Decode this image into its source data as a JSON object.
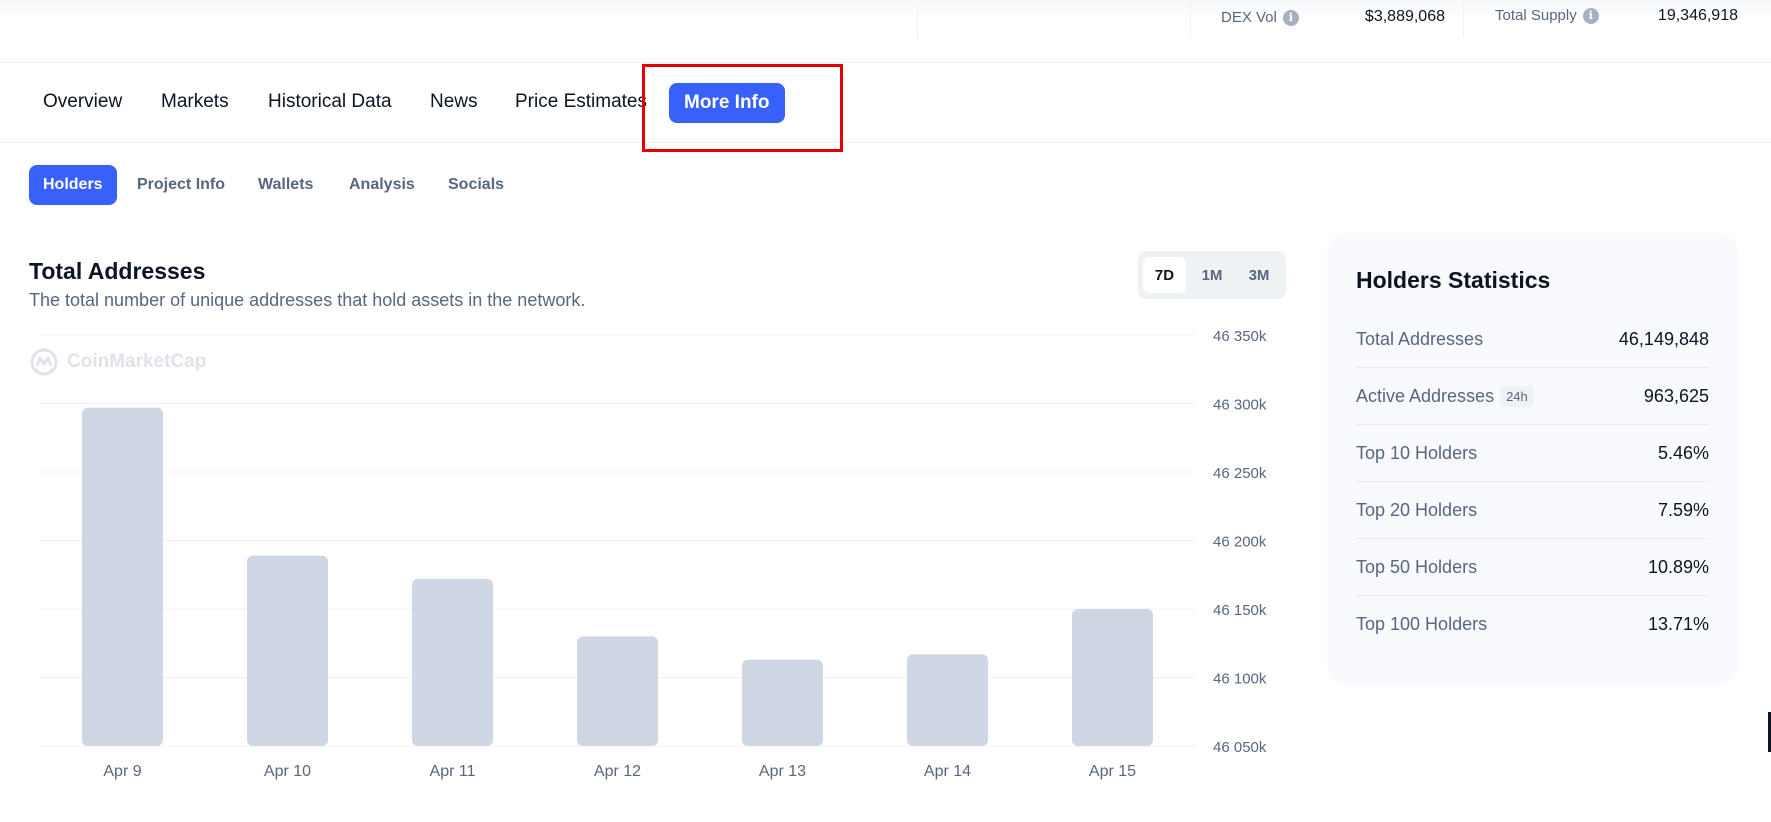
{
  "top_stats": {
    "dex_vol_label": "DEX Vol",
    "dex_vol_value": "$3,889,068",
    "total_supply_label": "Total Supply",
    "total_supply_value": "19,346,918",
    "info_icon_glyph": "i"
  },
  "main_tabs": [
    {
      "label": "Overview"
    },
    {
      "label": "Markets"
    },
    {
      "label": "Historical Data"
    },
    {
      "label": "News"
    },
    {
      "label": "Price Estimates"
    },
    {
      "label": "More Info",
      "active": true
    }
  ],
  "sub_tabs": [
    {
      "label": "Holders",
      "active": true
    },
    {
      "label": "Project Info"
    },
    {
      "label": "Wallets"
    },
    {
      "label": "Analysis"
    },
    {
      "label": "Socials"
    }
  ],
  "chart_section": {
    "title": "Total Addresses",
    "subtitle": "The total number of unique addresses that hold assets in the network.",
    "ranges": [
      {
        "label": "7D",
        "active": true
      },
      {
        "label": "1M"
      },
      {
        "label": "3M"
      }
    ],
    "watermark": "CoinMarketCap"
  },
  "chart_data": {
    "type": "bar",
    "categories": [
      "Apr 9",
      "Apr 10",
      "Apr 11",
      "Apr 12",
      "Apr 13",
      "Apr 14",
      "Apr 15"
    ],
    "values": [
      46297000,
      46189000,
      46172000,
      46130000,
      46113000,
      46117000,
      46150000
    ],
    "title": "Total Addresses",
    "xlabel": "",
    "ylabel": "",
    "ylim": [
      46050000,
      46350000
    ],
    "yticks": [
      46350000,
      46300000,
      46250000,
      46200000,
      46150000,
      46100000,
      46050000
    ],
    "ytick_labels": [
      "46 350k",
      "46 300k",
      "46 250k",
      "46 200k",
      "46 150k",
      "46 100k",
      "46 050k"
    ],
    "grid": true,
    "y_axis_position": "right",
    "bar_color": "#cfd6e4",
    "grid_color": "#eff2f5"
  },
  "holders_stats": {
    "title": "Holders Statistics",
    "rows": [
      {
        "label": "Total Addresses",
        "value": "46,149,848"
      },
      {
        "label": "Active Addresses",
        "badge": "24h",
        "value": "963,625"
      },
      {
        "label": "Top 10 Holders",
        "value": "5.46%"
      },
      {
        "label": "Top 20 Holders",
        "value": "7.59%"
      },
      {
        "label": "Top 50 Holders",
        "value": "10.89%"
      },
      {
        "label": "Top 100 Holders",
        "value": "13.71%"
      }
    ]
  },
  "colors": {
    "accent": "#3861fb",
    "highlight": "#e60000",
    "text_primary": "#0d1421",
    "text_secondary": "#58667e"
  }
}
